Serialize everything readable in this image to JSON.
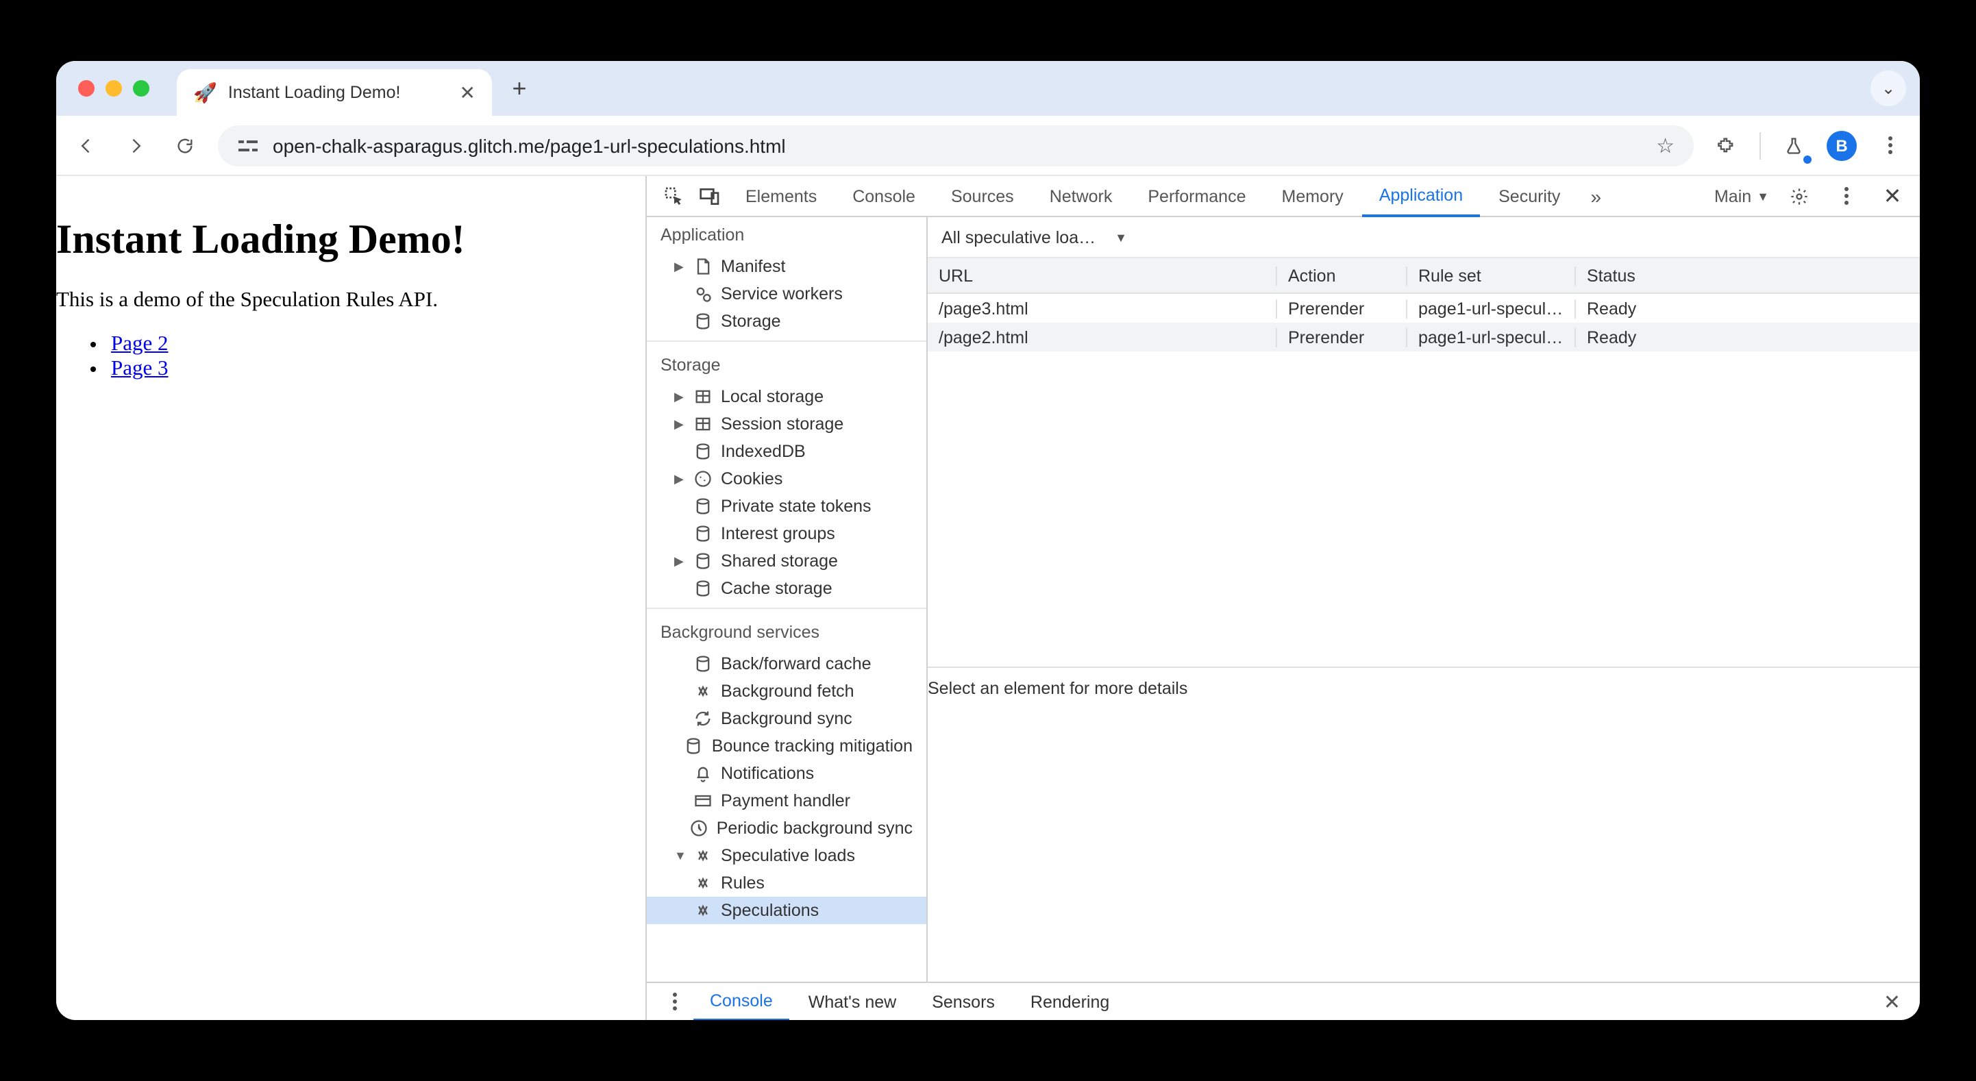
{
  "browser": {
    "tab_title": "Instant Loading Demo!",
    "url": "open-chalk-asparagus.glitch.me/page1-url-speculations.html",
    "avatar_letter": "B"
  },
  "page": {
    "heading": "Instant Loading Demo!",
    "paragraph": "This is a demo of the Speculation Rules API.",
    "links": [
      "Page 2",
      "Page 3"
    ]
  },
  "devtools": {
    "tabs": [
      "Elements",
      "Console",
      "Sources",
      "Network",
      "Performance",
      "Memory",
      "Application",
      "Security"
    ],
    "active_tab": "Application",
    "target_label": "Main",
    "sidebar": {
      "application": {
        "title": "Application",
        "items": [
          "Manifest",
          "Service workers",
          "Storage"
        ]
      },
      "storage": {
        "title": "Storage",
        "items": [
          "Local storage",
          "Session storage",
          "IndexedDB",
          "Cookies",
          "Private state tokens",
          "Interest groups",
          "Shared storage",
          "Cache storage"
        ]
      },
      "background": {
        "title": "Background services",
        "items": [
          "Back/forward cache",
          "Background fetch",
          "Background sync",
          "Bounce tracking mitigation",
          "Notifications",
          "Payment handler",
          "Periodic background sync",
          "Speculative loads"
        ],
        "spec_children": [
          "Rules",
          "Speculations"
        ],
        "selected": "Speculations"
      }
    },
    "main": {
      "dropdown": "All speculative loa…",
      "columns": [
        "URL",
        "Action",
        "Rule set",
        "Status"
      ],
      "rows": [
        {
          "url": "/page3.html",
          "action": "Prerender",
          "ruleset": "page1-url-specul…",
          "status": "Ready"
        },
        {
          "url": "/page2.html",
          "action": "Prerender",
          "ruleset": "page1-url-specul…",
          "status": "Ready"
        }
      ],
      "detail_hint": "Select an element for more details"
    },
    "drawer": {
      "tabs": [
        "Console",
        "What's new",
        "Sensors",
        "Rendering"
      ],
      "active": "Console"
    }
  }
}
